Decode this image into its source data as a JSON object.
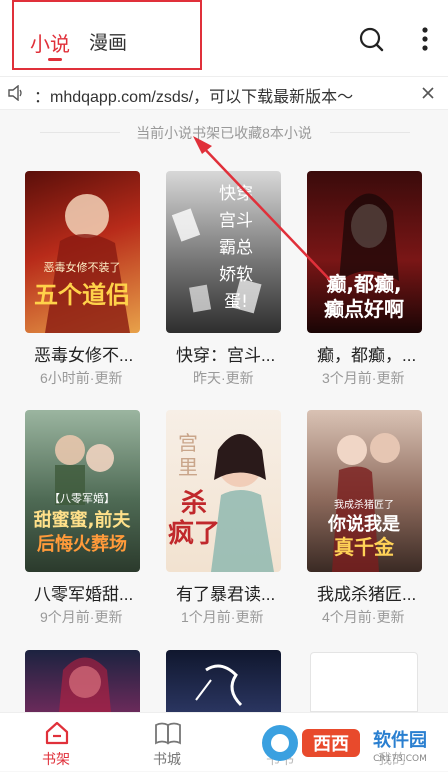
{
  "header": {
    "tabs": [
      {
        "label": "小说",
        "active": true
      },
      {
        "label": "漫画",
        "active": false
      }
    ],
    "icons": [
      "search-icon",
      "more-vertical-icon"
    ]
  },
  "notice": {
    "text": "：mhdqapp.com/zsds/，可以下载最新版本～",
    "icons": [
      "speaker-icon",
      "close-icon"
    ]
  },
  "shelf_info": "当前小说书架已收藏8本小说",
  "books": [
    {
      "title": "恶毒女修不...",
      "updated": "6小时前·更新",
      "cover_text": "恶毒女修不装了 开局 五个道侣"
    },
    {
      "title": "快穿：宫斗...",
      "updated": "昨天·更新",
      "cover_text": "快穿：宫斗 霸总 娇软 蛋！"
    },
    {
      "title": "癫，都癫，...",
      "updated": "3个月前·更新",
      "cover_text": "癫，都癫， 癫点好啊"
    },
    {
      "title": "八零军婚甜...",
      "updated": "9个月前·更新",
      "cover_text": "【八零军婚】 甜蜜蜜，前夫 后悔火葬场"
    },
    {
      "title": "有了暴君读...",
      "updated": "1个月前·更新",
      "cover_text": "宫里 杀疯了"
    },
    {
      "title": "我成杀猪匠...",
      "updated": "4个月前·更新",
      "cover_text": "我成杀猪匠了 你说我是 真千金"
    },
    {
      "title": "",
      "updated": "",
      "cover_text": ""
    },
    {
      "title": "",
      "updated": "",
      "cover_text": ""
    }
  ],
  "bottom_nav": [
    {
      "label": "书架",
      "active": true,
      "icon": "home-icon"
    },
    {
      "label": "书城",
      "active": false,
      "icon": "book-icon"
    },
    {
      "label": "书书",
      "active": false,
      "icon": "shelf-icon"
    },
    {
      "label": "我的",
      "active": false,
      "icon": "user-icon"
    }
  ],
  "watermark": "西西 软件园 CR173.COM",
  "colors": {
    "accent": "#e0303a",
    "muted": "#999999",
    "background": "#f7f7f7"
  }
}
